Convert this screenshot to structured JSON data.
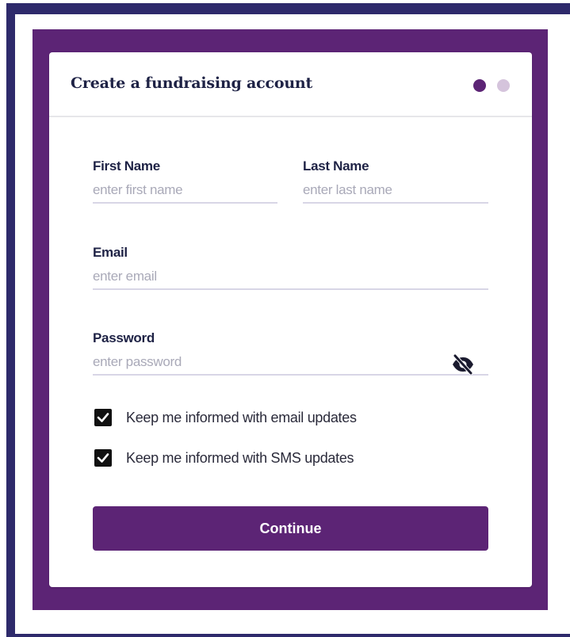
{
  "card": {
    "title": "Create a fundraising account",
    "steps": {
      "current": 1,
      "total": 2
    }
  },
  "form": {
    "first_name": {
      "label": "First Name",
      "placeholder": "enter first name",
      "value": ""
    },
    "last_name": {
      "label": "Last Name",
      "placeholder": "enter last name",
      "value": ""
    },
    "email": {
      "label": "Email",
      "placeholder": "enter email",
      "value": ""
    },
    "password": {
      "label": "Password",
      "placeholder": "enter password",
      "value": "",
      "visibility_icon": "eye-slash-icon"
    },
    "email_updates": {
      "label": "Keep me informed with email updates",
      "checked": true
    },
    "sms_updates": {
      "label": "Keep me informed with SMS updates",
      "checked": true
    },
    "continue_label": "Continue"
  },
  "colors": {
    "brand": "#5c2475",
    "frame": "#2e2a6b",
    "title_text": "#1e2245",
    "step_inactive": "#d5c4dc"
  }
}
